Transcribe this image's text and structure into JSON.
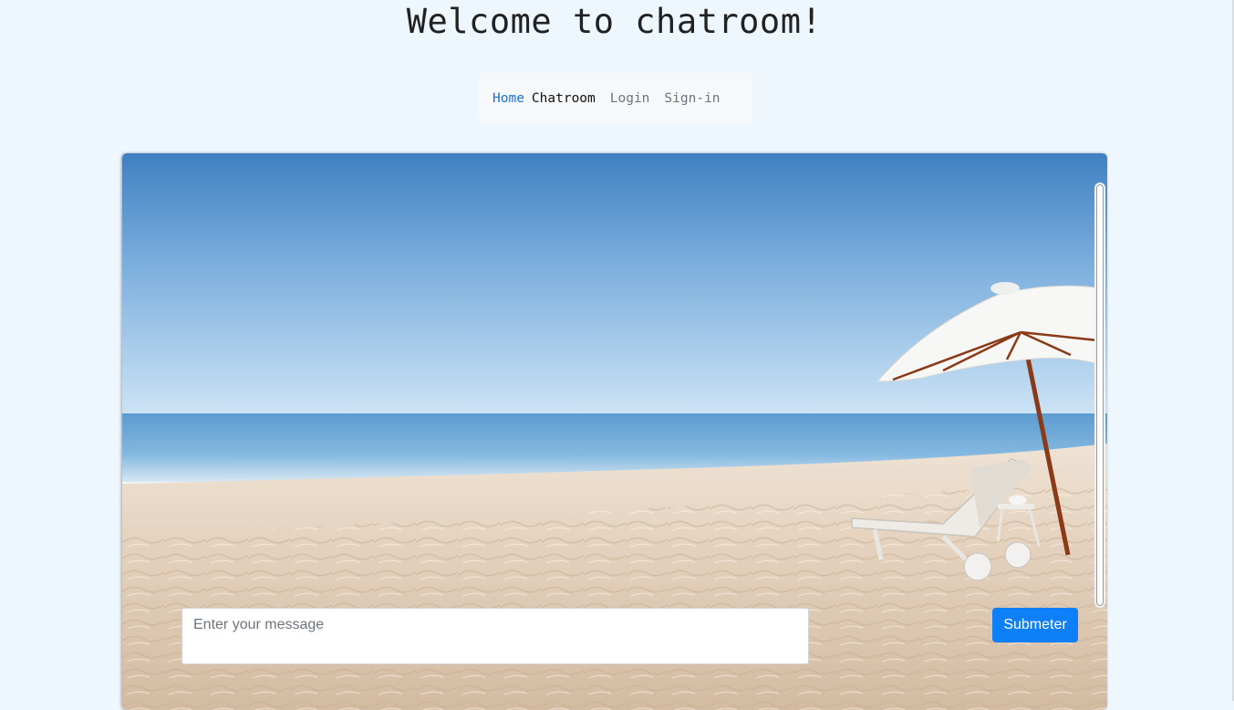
{
  "page": {
    "title": "Welcome to chatroom!"
  },
  "nav": {
    "home": "Home",
    "chatroom": "Chatroom",
    "login": "Login",
    "signin": "Sign-in"
  },
  "chat": {
    "background_image": "beach-photo",
    "message_placeholder": "Enter your message",
    "submit_label": "Submeter"
  },
  "colors": {
    "page_background": "#eff7fe",
    "primary": "#0d7ff7",
    "nav_active": "#1a6fd6"
  }
}
